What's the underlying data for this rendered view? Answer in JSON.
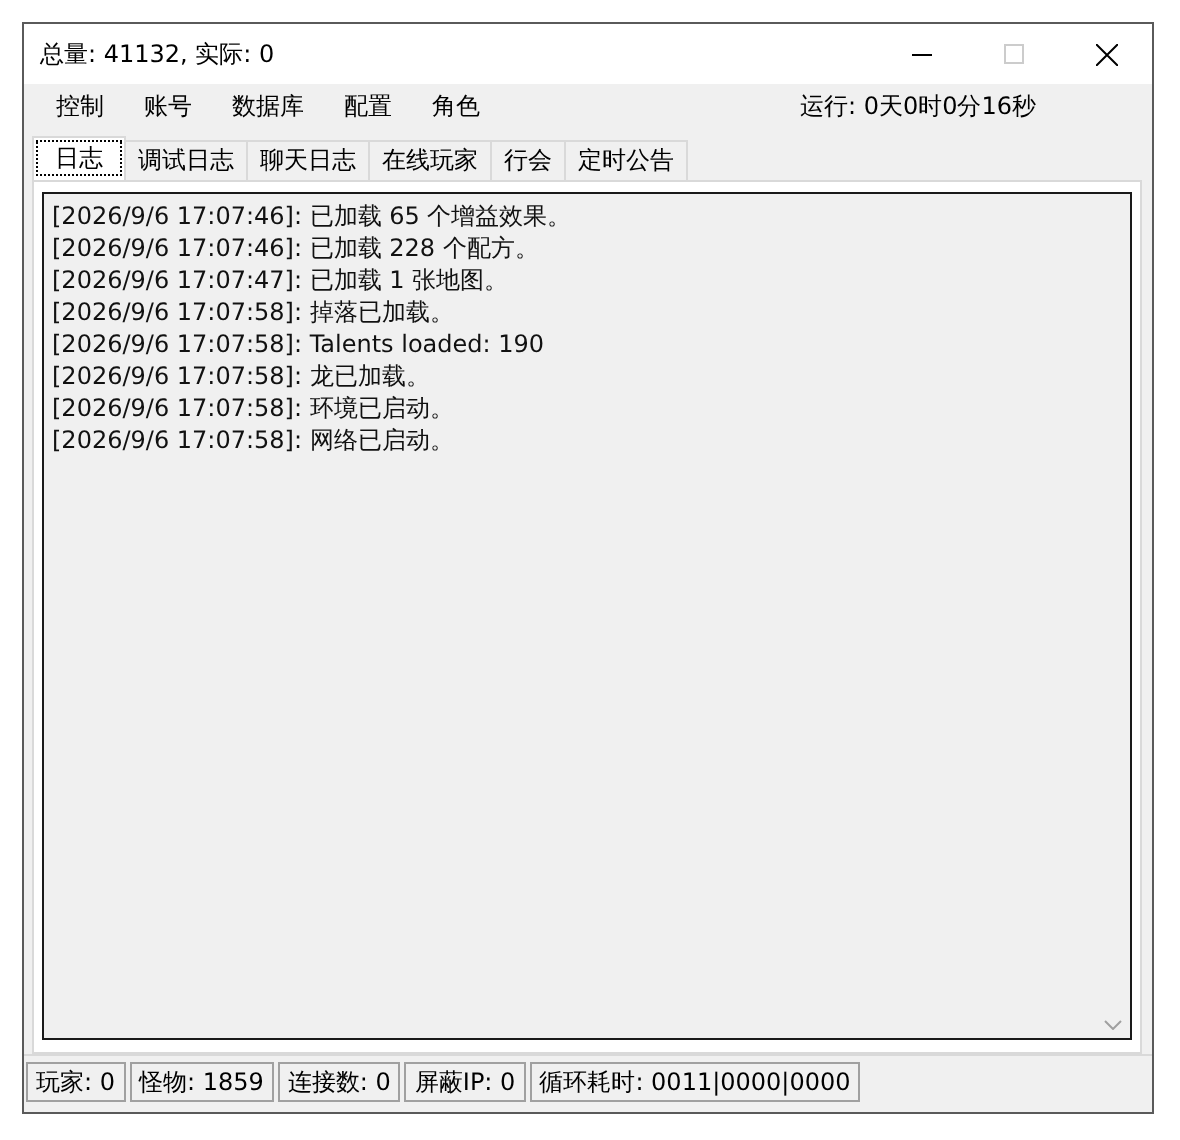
{
  "window": {
    "title": "总量: 41132, 实际: 0"
  },
  "menu": [
    "控制",
    "账号",
    "数据库",
    "配置",
    "角色"
  ],
  "uptime": "运行: 0天0时0分16秒",
  "tabs": [
    {
      "label": "日志",
      "selected": true
    },
    {
      "label": "调试日志",
      "selected": false
    },
    {
      "label": "聊天日志",
      "selected": false
    },
    {
      "label": "在线玩家",
      "selected": false
    },
    {
      "label": "行会",
      "selected": false
    },
    {
      "label": "定时公告",
      "selected": false
    }
  ],
  "log": [
    "[2026/9/6 17:07:46]: 已加载 65 个增益效果。",
    "[2026/9/6 17:07:46]: 已加载 228 个配方。",
    "[2026/9/6 17:07:47]: 已加载 1 张地图。",
    "[2026/9/6 17:07:58]: 掉落已加载。",
    "[2026/9/6 17:07:58]: Talents loaded: 190",
    "[2026/9/6 17:07:58]: 龙已加载。",
    "[2026/9/6 17:07:58]: 环境已启动。",
    "[2026/9/6 17:07:58]: 网络已启动。"
  ],
  "status_bar": [
    "玩家: 0",
    "怪物: 1859",
    "连接数: 0",
    "屏蔽IP: 0",
    "循环耗时: 0011|0000|0000"
  ]
}
